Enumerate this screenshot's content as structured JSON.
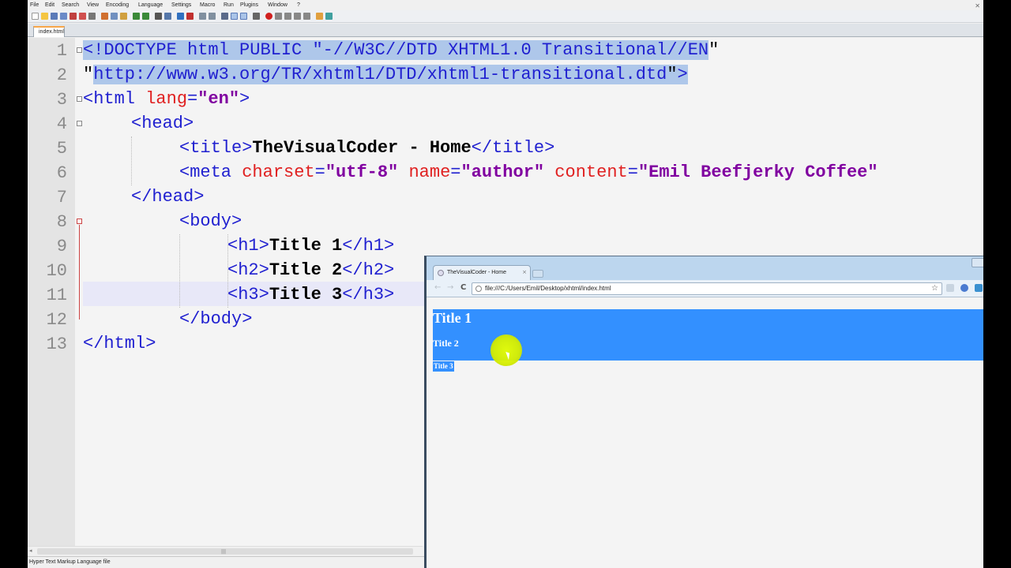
{
  "editor": {
    "menu": [
      "File",
      "Edit",
      "Search",
      "View",
      "Encoding",
      "Language",
      "Settings",
      "Macro",
      "Run",
      "Plugins",
      "Window",
      "?"
    ],
    "close_glyph": "✕",
    "tab_label": "index.html",
    "status_text": "Hyper Text Markup Language file",
    "line_numbers": [
      "1",
      "2",
      "3",
      "4",
      "5",
      "6",
      "7",
      "8",
      "9",
      "10",
      "11",
      "12",
      "13"
    ],
    "code": {
      "l1": {
        "a": "<!",
        "b": "DOCTYPE html PUBLIC \"",
        "c": "-//W3C//DTD XHTML1.0 Transitional//EN",
        "d": "\""
      },
      "l2": {
        "a": "\"",
        "b": "http://www.w3.org/TR/xhtml1/DTD/xhtml1-transitional.dtd",
        "c": "\"",
        "d": ">"
      },
      "l3": {
        "tag_open": "<html",
        "attr": " lang",
        "eq": "=",
        "val": "\"en\"",
        "tag_close": ">"
      },
      "l4": {
        "tag": "<head>"
      },
      "l5": {
        "open": "<title>",
        "text": "TheVisualCoder - Home",
        "close": "</title>"
      },
      "l6": {
        "tag": "<meta",
        "a1": " charset",
        "eq1": "=",
        "v1": "\"utf-8\"",
        "a2": " name",
        "eq2": "=",
        "v2": "\"author\"",
        "a3": " content",
        "eq3": "=",
        "v3": "\"Emil Beefjerky Coffee\""
      },
      "l7": {
        "tag": "</head>"
      },
      "l8": {
        "tag": "<body>"
      },
      "l9": {
        "open": "<h1>",
        "text": "Title 1",
        "close": "</h1>"
      },
      "l10": {
        "open": "<h2>",
        "text": "Title 2",
        "close": "</h2>"
      },
      "l11": {
        "open": "<h3>",
        "text": "Title 3",
        "close": "</h3>"
      },
      "l12": {
        "tag": "</body>"
      },
      "l13": {
        "tag": "</html>"
      }
    }
  },
  "browser": {
    "tab_title": "TheVisualCoder - Home",
    "tab_close": "×",
    "back": "←",
    "forward": "→",
    "reload": "C",
    "url": "file:///C:/Users/Emil/Desktop/xhtml/index.html",
    "star": "☆",
    "h1": "Title 1",
    "h2": "Title 2",
    "h3": "Title 3"
  },
  "colors": {
    "selection": "#aec7ea",
    "tag": "#2020d0",
    "attribute": "#e02020",
    "value": "#8000a0",
    "browser_selection": "#3390ff",
    "cursor_highlight": "#d8f000"
  }
}
